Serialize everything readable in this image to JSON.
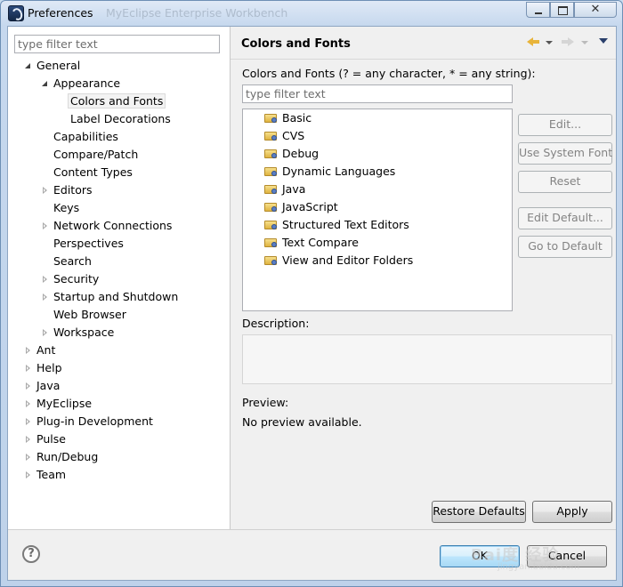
{
  "window": {
    "title": "Preferences",
    "background_title": "MyEclipse Enterprise Workbench"
  },
  "left": {
    "filter_placeholder": "type filter text",
    "tree": [
      {
        "label": "General",
        "level": 0,
        "state": "open"
      },
      {
        "label": "Appearance",
        "level": 1,
        "state": "open"
      },
      {
        "label": "Colors and Fonts",
        "level": 2,
        "state": "leaf",
        "selected": true
      },
      {
        "label": "Label Decorations",
        "level": 2,
        "state": "leaf"
      },
      {
        "label": "Capabilities",
        "level": 1,
        "state": "leaf"
      },
      {
        "label": "Compare/Patch",
        "level": 1,
        "state": "leaf"
      },
      {
        "label": "Content Types",
        "level": 1,
        "state": "leaf"
      },
      {
        "label": "Editors",
        "level": 1,
        "state": "closed"
      },
      {
        "label": "Keys",
        "level": 1,
        "state": "leaf"
      },
      {
        "label": "Network Connections",
        "level": 1,
        "state": "closed"
      },
      {
        "label": "Perspectives",
        "level": 1,
        "state": "leaf"
      },
      {
        "label": "Search",
        "level": 1,
        "state": "leaf"
      },
      {
        "label": "Security",
        "level": 1,
        "state": "closed"
      },
      {
        "label": "Startup and Shutdown",
        "level": 1,
        "state": "closed"
      },
      {
        "label": "Web Browser",
        "level": 1,
        "state": "leaf"
      },
      {
        "label": "Workspace",
        "level": 1,
        "state": "closed"
      },
      {
        "label": "Ant",
        "level": 0,
        "state": "closed"
      },
      {
        "label": "Help",
        "level": 0,
        "state": "closed"
      },
      {
        "label": "Java",
        "level": 0,
        "state": "closed"
      },
      {
        "label": "MyEclipse",
        "level": 0,
        "state": "closed"
      },
      {
        "label": "Plug-in Development",
        "level": 0,
        "state": "closed"
      },
      {
        "label": "Pulse",
        "level": 0,
        "state": "closed"
      },
      {
        "label": "Run/Debug",
        "level": 0,
        "state": "closed"
      },
      {
        "label": "Team",
        "level": 0,
        "state": "closed"
      }
    ]
  },
  "page": {
    "title": "Colors and Fonts",
    "intro": "Colors and Fonts (? = any character, * = any string):",
    "filter_placeholder": "type filter text",
    "categories": [
      "Basic",
      "CVS",
      "Debug",
      "Dynamic Languages",
      "Java",
      "JavaScript",
      "Structured Text Editors",
      "Text Compare",
      "View and Editor Folders"
    ],
    "buttons": {
      "edit": "Edit...",
      "use_system_font": "Use System Font",
      "reset": "Reset",
      "edit_default": "Edit Default...",
      "go_to_default": "Go to Default"
    },
    "description_label": "Description:",
    "preview_label": "Preview:",
    "preview_text": "No preview available.",
    "restore_defaults": "Restore Defaults",
    "apply": "Apply"
  },
  "dialog": {
    "ok": "OK",
    "cancel": "Cancel",
    "help_glyph": "?"
  },
  "watermark": {
    "line1": "Bai度 经验",
    "line2": "jingyan.baidu.com"
  }
}
